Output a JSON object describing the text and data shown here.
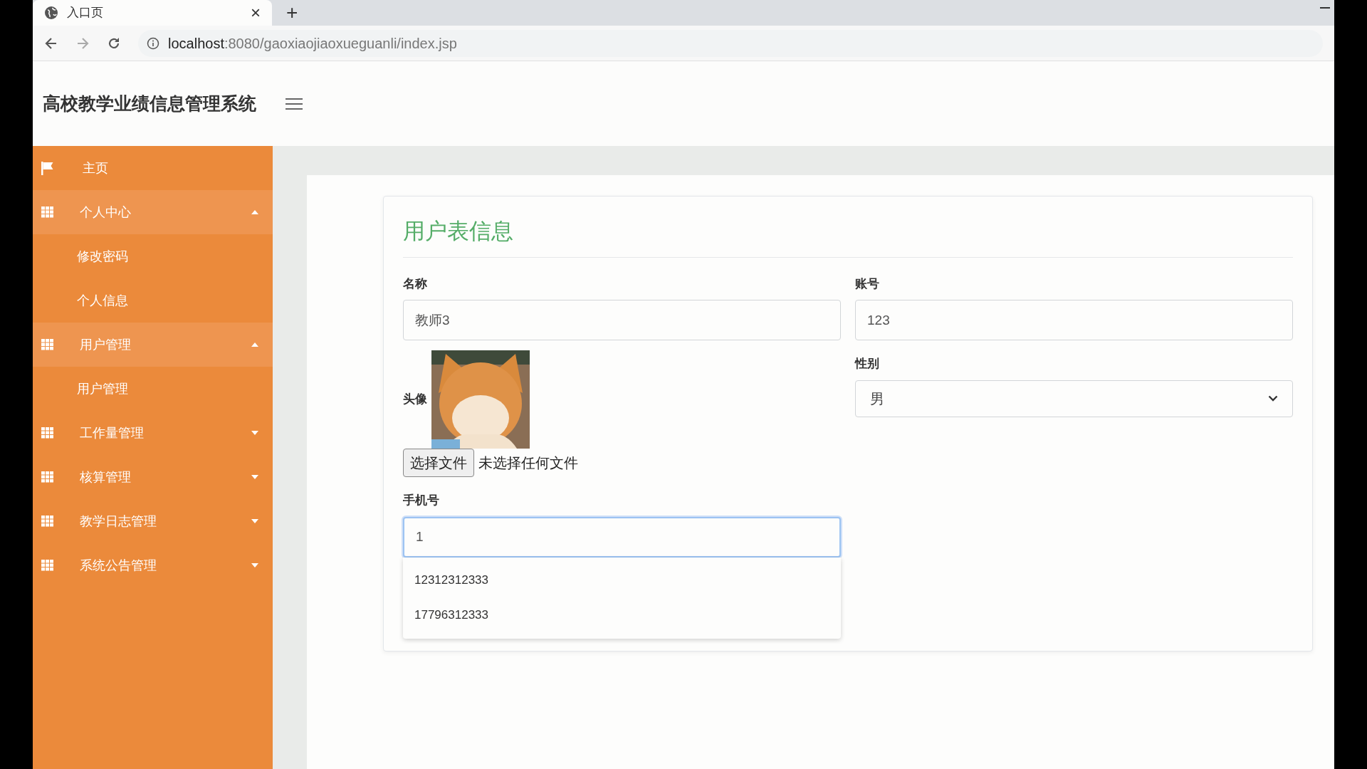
{
  "browser": {
    "tab": {
      "title": "入口页",
      "close": "×",
      "selected": true
    },
    "new_tab": "+",
    "url_host": "localhost",
    "url_rest": ":8080/gaoxiaojiaoxueguanli/index.jsp"
  },
  "header": {
    "title": "高校教学业绩信息管理系统"
  },
  "sidebar": {
    "items": [
      {
        "kind": "link",
        "label": "主页"
      },
      {
        "kind": "group",
        "label": "个人中心",
        "expanded": true,
        "children": [
          {
            "label": "修改密码"
          },
          {
            "label": "个人信息"
          }
        ]
      },
      {
        "kind": "group",
        "label": "用户管理",
        "expanded": true,
        "children": [
          {
            "label": "用户管理"
          }
        ]
      },
      {
        "kind": "group",
        "label": "工作量管理",
        "expanded": false
      },
      {
        "kind": "group",
        "label": "核算管理",
        "expanded": false
      },
      {
        "kind": "group",
        "label": "教学日志管理",
        "expanded": false
      },
      {
        "kind": "group",
        "label": "系统公告管理",
        "expanded": false
      }
    ]
  },
  "form": {
    "title": "用户表信息",
    "columns": [
      {
        "fields": [
          {
            "kind": "text",
            "label": "名称",
            "value": "教师3",
            "focused": false
          },
          {
            "label": "头像",
            "button": "选择文件",
            "status": "未选择任何文件"
          },
          {
            "kind": "text",
            "label": "手机号",
            "value": "1",
            "focused": true,
            "suggestions": [
              "12312312333",
              "17796312333"
            ]
          }
        ]
      },
      {
        "fields": [
          {
            "kind": "text",
            "label": "账号",
            "value": "123",
            "focused": false
          },
          {
            "kind": "select",
            "label": "性别",
            "value": "男"
          }
        ]
      }
    ]
  }
}
